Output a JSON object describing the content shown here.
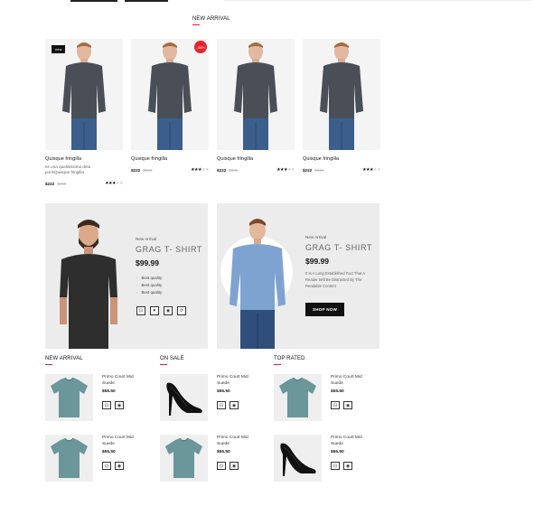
{
  "sections": {
    "new_arrival_main": "NEW ARRIVAL",
    "new_arrival_list": "NEW ARRIVAL",
    "on_sale": "ON SALE",
    "top_rated": "TOP RATED"
  },
  "products": [
    {
      "name": "Quisque fringilla",
      "desc": "es una qualisissima dela porisQuisque fringilla",
      "price": "$222",
      "old": "$300",
      "badge": "new",
      "rating": 3
    },
    {
      "name": "Quisque fringilla",
      "price": "$222",
      "old": "$300",
      "badge": "-30%",
      "rating": 3
    },
    {
      "name": "Quisque fringilla",
      "price": "$222",
      "old": "$300",
      "badge": "",
      "rating": 3
    },
    {
      "name": "Quisque fringilla",
      "price": "$222",
      "old": "$300",
      "badge": "",
      "rating": 3
    }
  ],
  "banner_left": {
    "label": "New Arrival",
    "title": "GRAG T- SHIRT",
    "price": "$99.99",
    "features": [
      "Best quality",
      "Best quality",
      "Best quality"
    ]
  },
  "banner_right": {
    "label": "New Arrival",
    "title": "GRAG T- SHIRT",
    "price": "$99.99",
    "desc": "It Is A Long Established Fact That A Reader Will Be Distracted By The Readable Content",
    "button": "SHOP NOW"
  },
  "mini_item": {
    "name": "Primo Court Mid Suede",
    "price": "$55.50"
  },
  "colors": {
    "accent": "#e3242b",
    "banner_bg": "#ececec",
    "shirt_teal": "#6b969a"
  }
}
